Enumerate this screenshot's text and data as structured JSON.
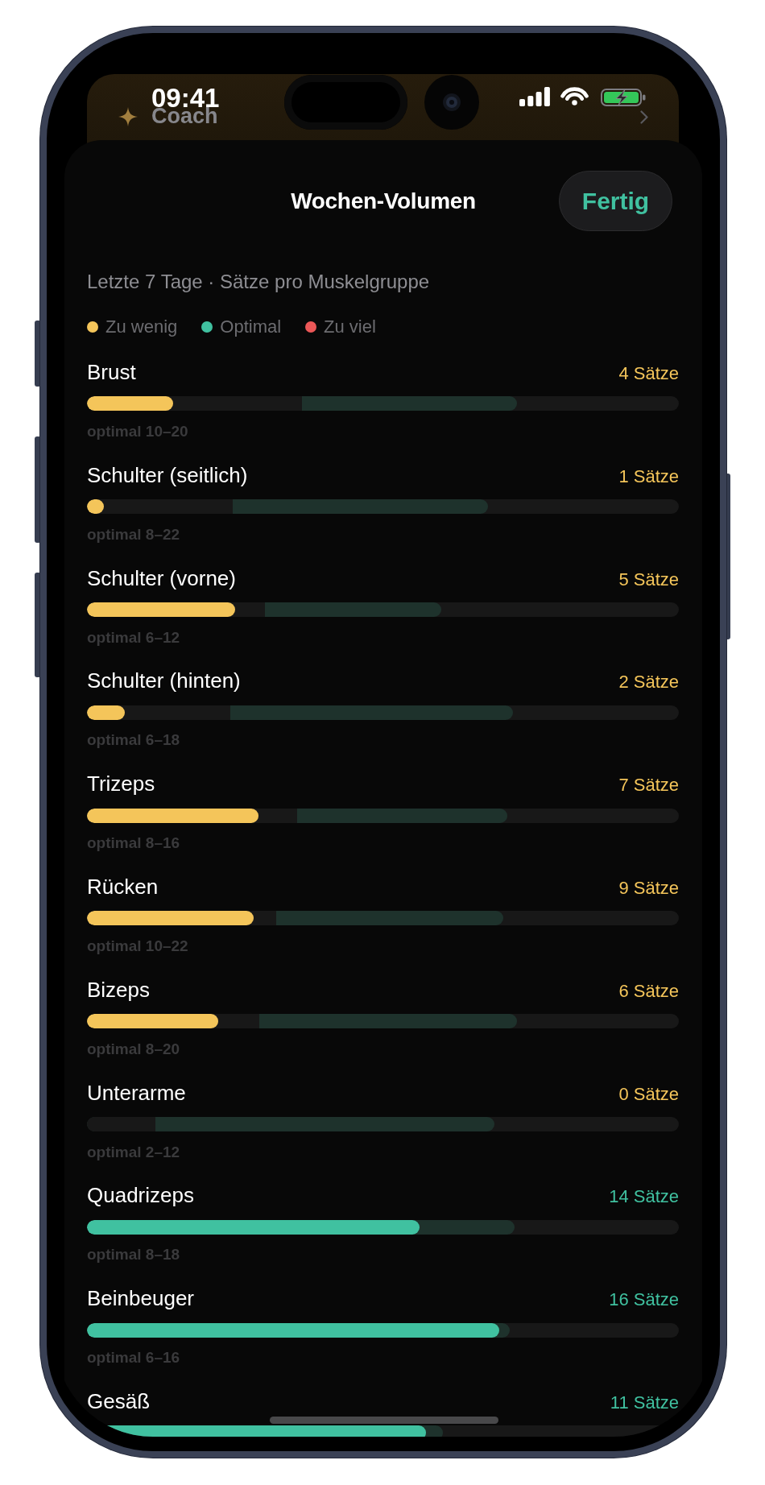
{
  "status_bar": {
    "time": "09:41"
  },
  "background_card": {
    "title": "Coach"
  },
  "sheet": {
    "title": "Wochen-Volumen",
    "done_button": "Fertig",
    "subtitle": "Letzte 7 Tage · Sätze pro Muskelgruppe"
  },
  "legend": [
    {
      "label": "Zu wenig",
      "color": "#f4c55a"
    },
    {
      "label": "Optimal",
      "color": "#40c1a0"
    },
    {
      "label": "Zu viel",
      "color": "#eb5757"
    }
  ],
  "rows": [
    {
      "name": "Brust",
      "sets": "4 Sätze",
      "color": "#f4c55a",
      "level": 0.146,
      "optimal_zone": {
        "start": {
          "level": 0.363
        },
        "end": {
          "level": 0.726
        }
      },
      "range": "optimal 10–20"
    },
    {
      "name": "Schulter (seitlich)",
      "sets": "1 Sätze",
      "color": "#f4c55a",
      "level": 0.029,
      "optimal_zone": {
        "start": {
          "level": 0.246
        },
        "end": {
          "level": 0.677
        }
      },
      "range": "optimal 8–22"
    },
    {
      "name": "Schulter (vorne)",
      "sets": "5 Sätze",
      "color": "#f4c55a",
      "level": 0.25,
      "optimal_zone": {
        "start": {
          "level": 0.3
        },
        "end": {
          "level": 0.598
        }
      },
      "range": "optimal 6–12"
    },
    {
      "name": "Schulter (hinten)",
      "sets": "2 Sätze",
      "color": "#f4c55a",
      "level": 0.064,
      "optimal_zone": {
        "start": {
          "level": 0.242
        },
        "end": {
          "level": 0.72
        }
      },
      "range": "optimal 6–18"
    },
    {
      "name": "Trizeps",
      "sets": "7 Sätze",
      "color": "#f4c55a",
      "level": 0.29,
      "optimal_zone": {
        "start": {
          "level": 0.355
        },
        "end": {
          "level": 0.71
        }
      },
      "range": "optimal 8–16"
    },
    {
      "name": "Rücken",
      "sets": "9 Sätze",
      "color": "#f4c55a",
      "level": 0.282,
      "optimal_zone": {
        "start": {
          "level": 0.32
        },
        "end": {
          "level": 0.704
        }
      },
      "range": "optimal 10–22"
    },
    {
      "name": "Bizeps",
      "sets": "6 Sätze",
      "color": "#f4c55a",
      "level": 0.222,
      "optimal_zone": {
        "start": {
          "level": 0.291
        },
        "end": {
          "level": 0.726
        }
      },
      "range": "optimal 8–20"
    },
    {
      "name": "Unterarme",
      "sets": "0 Sätze",
      "color": "#f4c55a",
      "optimal_zone": {
        "start": {
          "level": 0.115
        },
        "end": {
          "level": 0.688
        }
      },
      "range": "optimal 2–12"
    },
    {
      "name": "Quadrizeps",
      "sets": "14 Sätze",
      "color": "#40c1a0",
      "level": 0.562,
      "optimal_zone": {
        "end": {
          "level": 0.723
        }
      },
      "range": "optimal 8–18"
    },
    {
      "name": "Beinbeuger",
      "sets": "16 Sätze",
      "color": "#40c1a0",
      "level": 0.697,
      "optimal_zone": {
        "end": {
          "level": 0.714
        }
      },
      "range": "optimal 6–16"
    },
    {
      "name": "Gesäß",
      "sets": "11 Sätze",
      "color": "#40c1a0",
      "level": 0.573,
      "optimal_zone": {
        "end": {
          "level": 0.601
        }
      }
    }
  ]
}
